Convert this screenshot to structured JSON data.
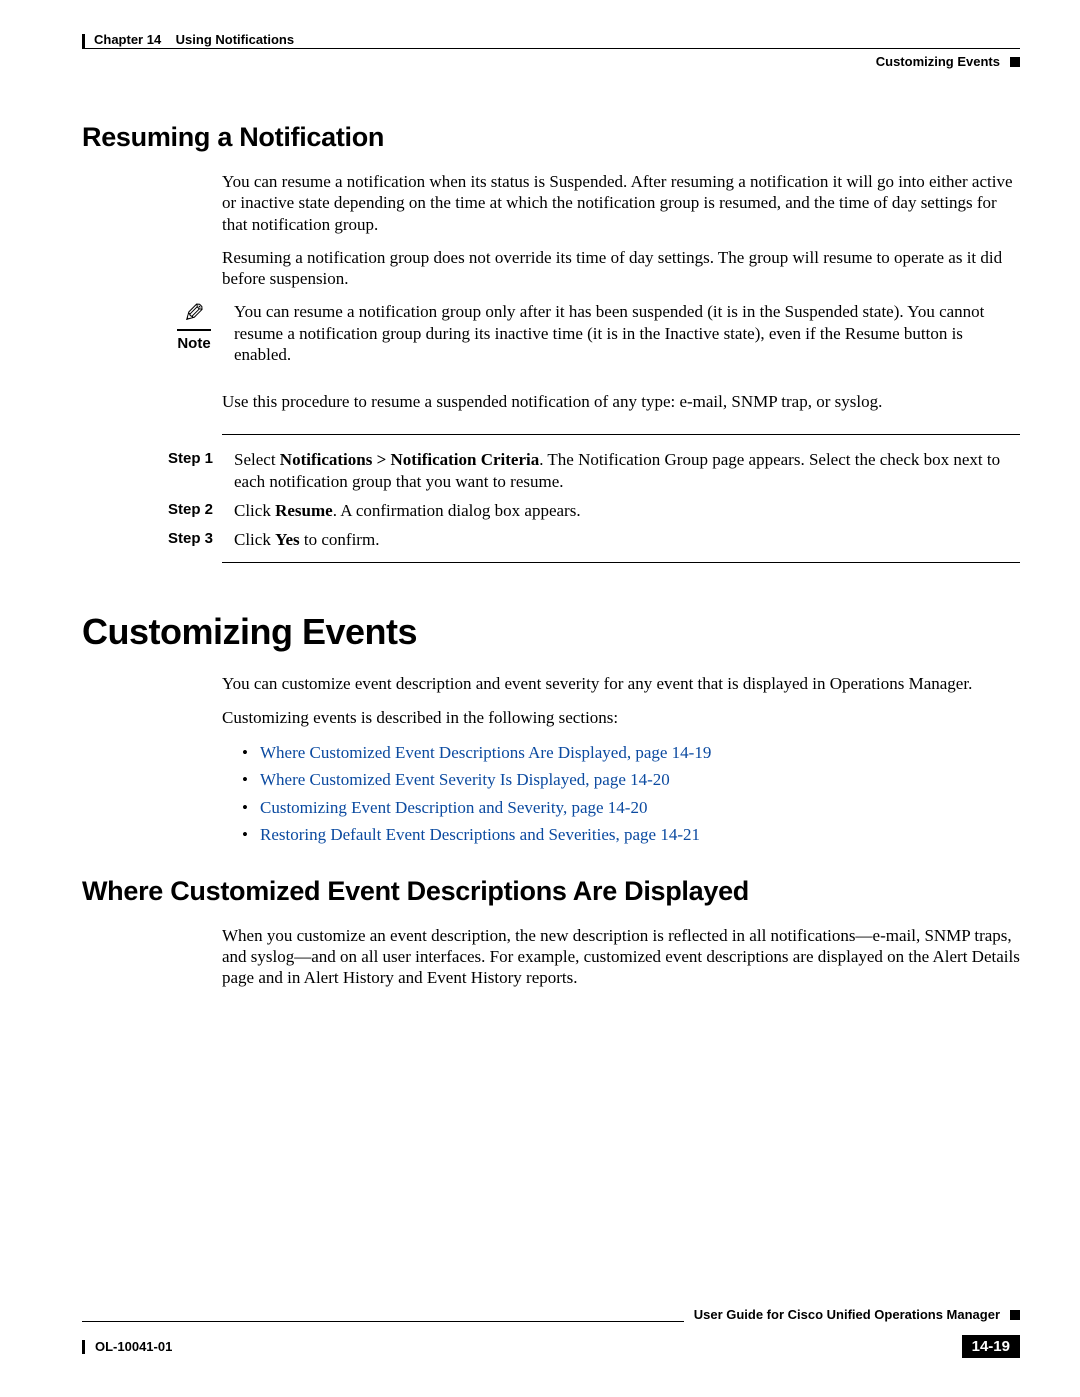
{
  "header": {
    "chapter_label": "Chapter 14",
    "chapter_title": "Using Notifications",
    "section_right": "Customizing Events"
  },
  "section1": {
    "heading": "Resuming a Notification",
    "p1": "You can resume a notification when its status is Suspended. After resuming a notification it will go into either active or inactive state depending on the time at which the notification group is resumed, and the time of day settings for that notification group.",
    "p2": "Resuming a notification group does not override its time of day settings. The group will resume to operate as it did before suspension.",
    "note_label": "Note",
    "note": "You can resume a notification group only after it has been suspended (it is in the Suspended state). You cannot resume a notification group during its inactive time (it is in the Inactive state), even if the Resume button is enabled.",
    "p3": "Use this procedure to resume a suspended notification of any type: e-mail, SNMP trap, or syslog.",
    "steps": [
      {
        "label": "Step 1",
        "pre": "Select ",
        "b": "Notifications > Notification Criteria",
        "post": ". The Notification Group page appears. Select the check box next to each notification group that you want to resume."
      },
      {
        "label": "Step 2",
        "pre": "Click ",
        "b": "Resume",
        "post": ". A confirmation dialog box appears."
      },
      {
        "label": "Step 3",
        "pre": "Click ",
        "b": "Yes",
        "post": " to confirm."
      }
    ]
  },
  "section2": {
    "heading": "Customizing Events",
    "p1": "You can customize event description and event severity for any event that is displayed in Operations Manager.",
    "p2": "Customizing events is described in the following sections:",
    "links": [
      "Where Customized Event Descriptions Are Displayed, page 14-19",
      "Where Customized Event Severity Is Displayed, page 14-20",
      "Customizing Event Description and Severity, page 14-20",
      "Restoring Default Event Descriptions and Severities, page 14-21"
    ]
  },
  "section3": {
    "heading": "Where Customized Event Descriptions Are Displayed",
    "p1": "When you customize an event description, the new description is reflected in all notifications—e-mail, SNMP traps, and syslog—and on all user interfaces. For example, customized event descriptions are displayed on the Alert Details page and in Alert History and Event History reports."
  },
  "footer": {
    "doc_title": "User Guide for Cisco Unified Operations Manager",
    "doc_id": "OL-10041-01",
    "page_number": "14-19"
  }
}
